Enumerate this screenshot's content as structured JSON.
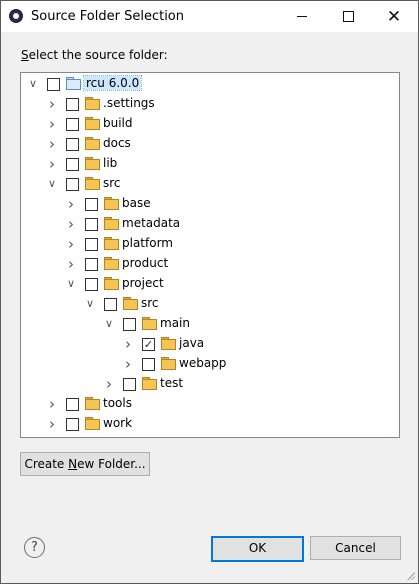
{
  "window": {
    "title": "Source Folder Selection",
    "icon": "eclipse-icon",
    "min_icon": "minimize-icon",
    "max_icon": "maximize-icon",
    "close_label": "✕"
  },
  "prompt": {
    "mnemonic": "S",
    "rest": "elect the source folder:"
  },
  "tree": [
    {
      "label": "rcu 6.0.0",
      "depth": 0,
      "toggle": "v",
      "checked": false,
      "kind": "project",
      "selected": true
    },
    {
      "label": ".settings",
      "depth": 1,
      "toggle": ">",
      "checked": false,
      "kind": "folder"
    },
    {
      "label": "build",
      "depth": 1,
      "toggle": ">",
      "checked": false,
      "kind": "folder"
    },
    {
      "label": "docs",
      "depth": 1,
      "toggle": ">",
      "checked": false,
      "kind": "folder"
    },
    {
      "label": "lib",
      "depth": 1,
      "toggle": ">",
      "checked": false,
      "kind": "folder"
    },
    {
      "label": "src",
      "depth": 1,
      "toggle": "v",
      "checked": false,
      "kind": "folder"
    },
    {
      "label": "base",
      "depth": 2,
      "toggle": ">",
      "checked": false,
      "kind": "folder"
    },
    {
      "label": "metadata",
      "depth": 2,
      "toggle": ">",
      "checked": false,
      "kind": "folder"
    },
    {
      "label": "platform",
      "depth": 2,
      "toggle": ">",
      "checked": false,
      "kind": "folder"
    },
    {
      "label": "product",
      "depth": 2,
      "toggle": ">",
      "checked": false,
      "kind": "folder"
    },
    {
      "label": "project",
      "depth": 2,
      "toggle": "v",
      "checked": false,
      "kind": "folder"
    },
    {
      "label": "src",
      "depth": 3,
      "toggle": "v",
      "checked": false,
      "kind": "folder"
    },
    {
      "label": "main",
      "depth": 4,
      "toggle": "v",
      "checked": false,
      "kind": "folder"
    },
    {
      "label": "java",
      "depth": 5,
      "toggle": ">",
      "checked": true,
      "kind": "folder"
    },
    {
      "label": "webapp",
      "depth": 5,
      "toggle": ">",
      "checked": false,
      "kind": "folder"
    },
    {
      "label": "test",
      "depth": 4,
      "toggle": ">",
      "checked": false,
      "kind": "folder"
    },
    {
      "label": "tools",
      "depth": 1,
      "toggle": ">",
      "checked": false,
      "kind": "folder"
    },
    {
      "label": "work",
      "depth": 1,
      "toggle": ">",
      "checked": false,
      "kind": "folder"
    }
  ],
  "buttons": {
    "create_prefix": "Create ",
    "create_mnemonic": "N",
    "create_suffix": "ew Folder...",
    "ok": "OK",
    "cancel": "Cancel",
    "help": "?"
  }
}
